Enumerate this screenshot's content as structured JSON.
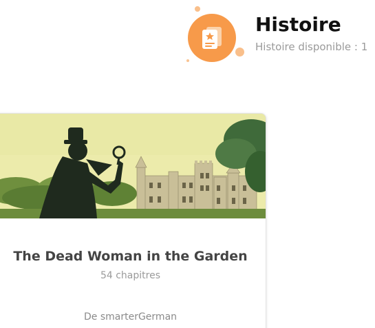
{
  "header": {
    "title": "Histoire",
    "subtitle": "Histoire disponible : 1",
    "icon": "story-book-star-icon"
  },
  "story": {
    "title": "The Dead Woman in the Garden",
    "chapters": "54 chapitres",
    "author": "De smarterGerman",
    "cover_image": "detective-silhouette-castle-cover"
  },
  "colors": {
    "accent": "#f79a4a",
    "accent_light": "#f8b477"
  }
}
